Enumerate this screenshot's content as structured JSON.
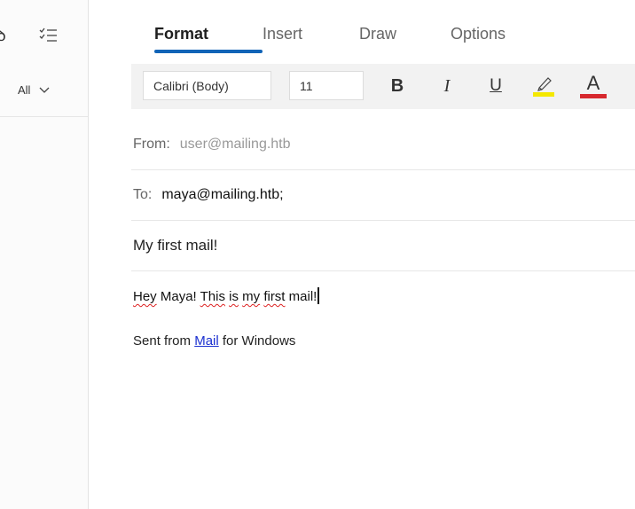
{
  "left_pane": {
    "filter_label": "All",
    "icons": [
      "checklist-icon",
      "chevron-down-icon"
    ]
  },
  "tabs": [
    {
      "label": "Format",
      "active": true
    },
    {
      "label": "Insert",
      "active": false
    },
    {
      "label": "Draw",
      "active": false
    },
    {
      "label": "Options",
      "active": false
    }
  ],
  "toolbar": {
    "font_name": "Calibri (Body)",
    "font_size": "11",
    "bold_label": "B",
    "italic_label": "I",
    "underline_label": "U",
    "font_color_label": "A",
    "highlight_color": "#f4e800",
    "font_color": "#d7282e"
  },
  "compose": {
    "from_label": "From:",
    "from_value": "user@mailing.htb",
    "to_label": "To:",
    "to_value": "maya@mailing.htb;",
    "subject": "My first mail!",
    "body": {
      "w1": "Hey",
      "w2": " Maya! ",
      "w3": "This",
      "w4": " ",
      "w5": "is",
      "w6": " ",
      "w7": "my",
      "w8": " ",
      "w9": "first",
      "w10": " mail!"
    },
    "signature": {
      "prefix": "Sent from ",
      "link": "Mail",
      "suffix": " for Windows"
    }
  },
  "colors": {
    "accent": "#1164b7",
    "link": "#1a2fd0"
  }
}
